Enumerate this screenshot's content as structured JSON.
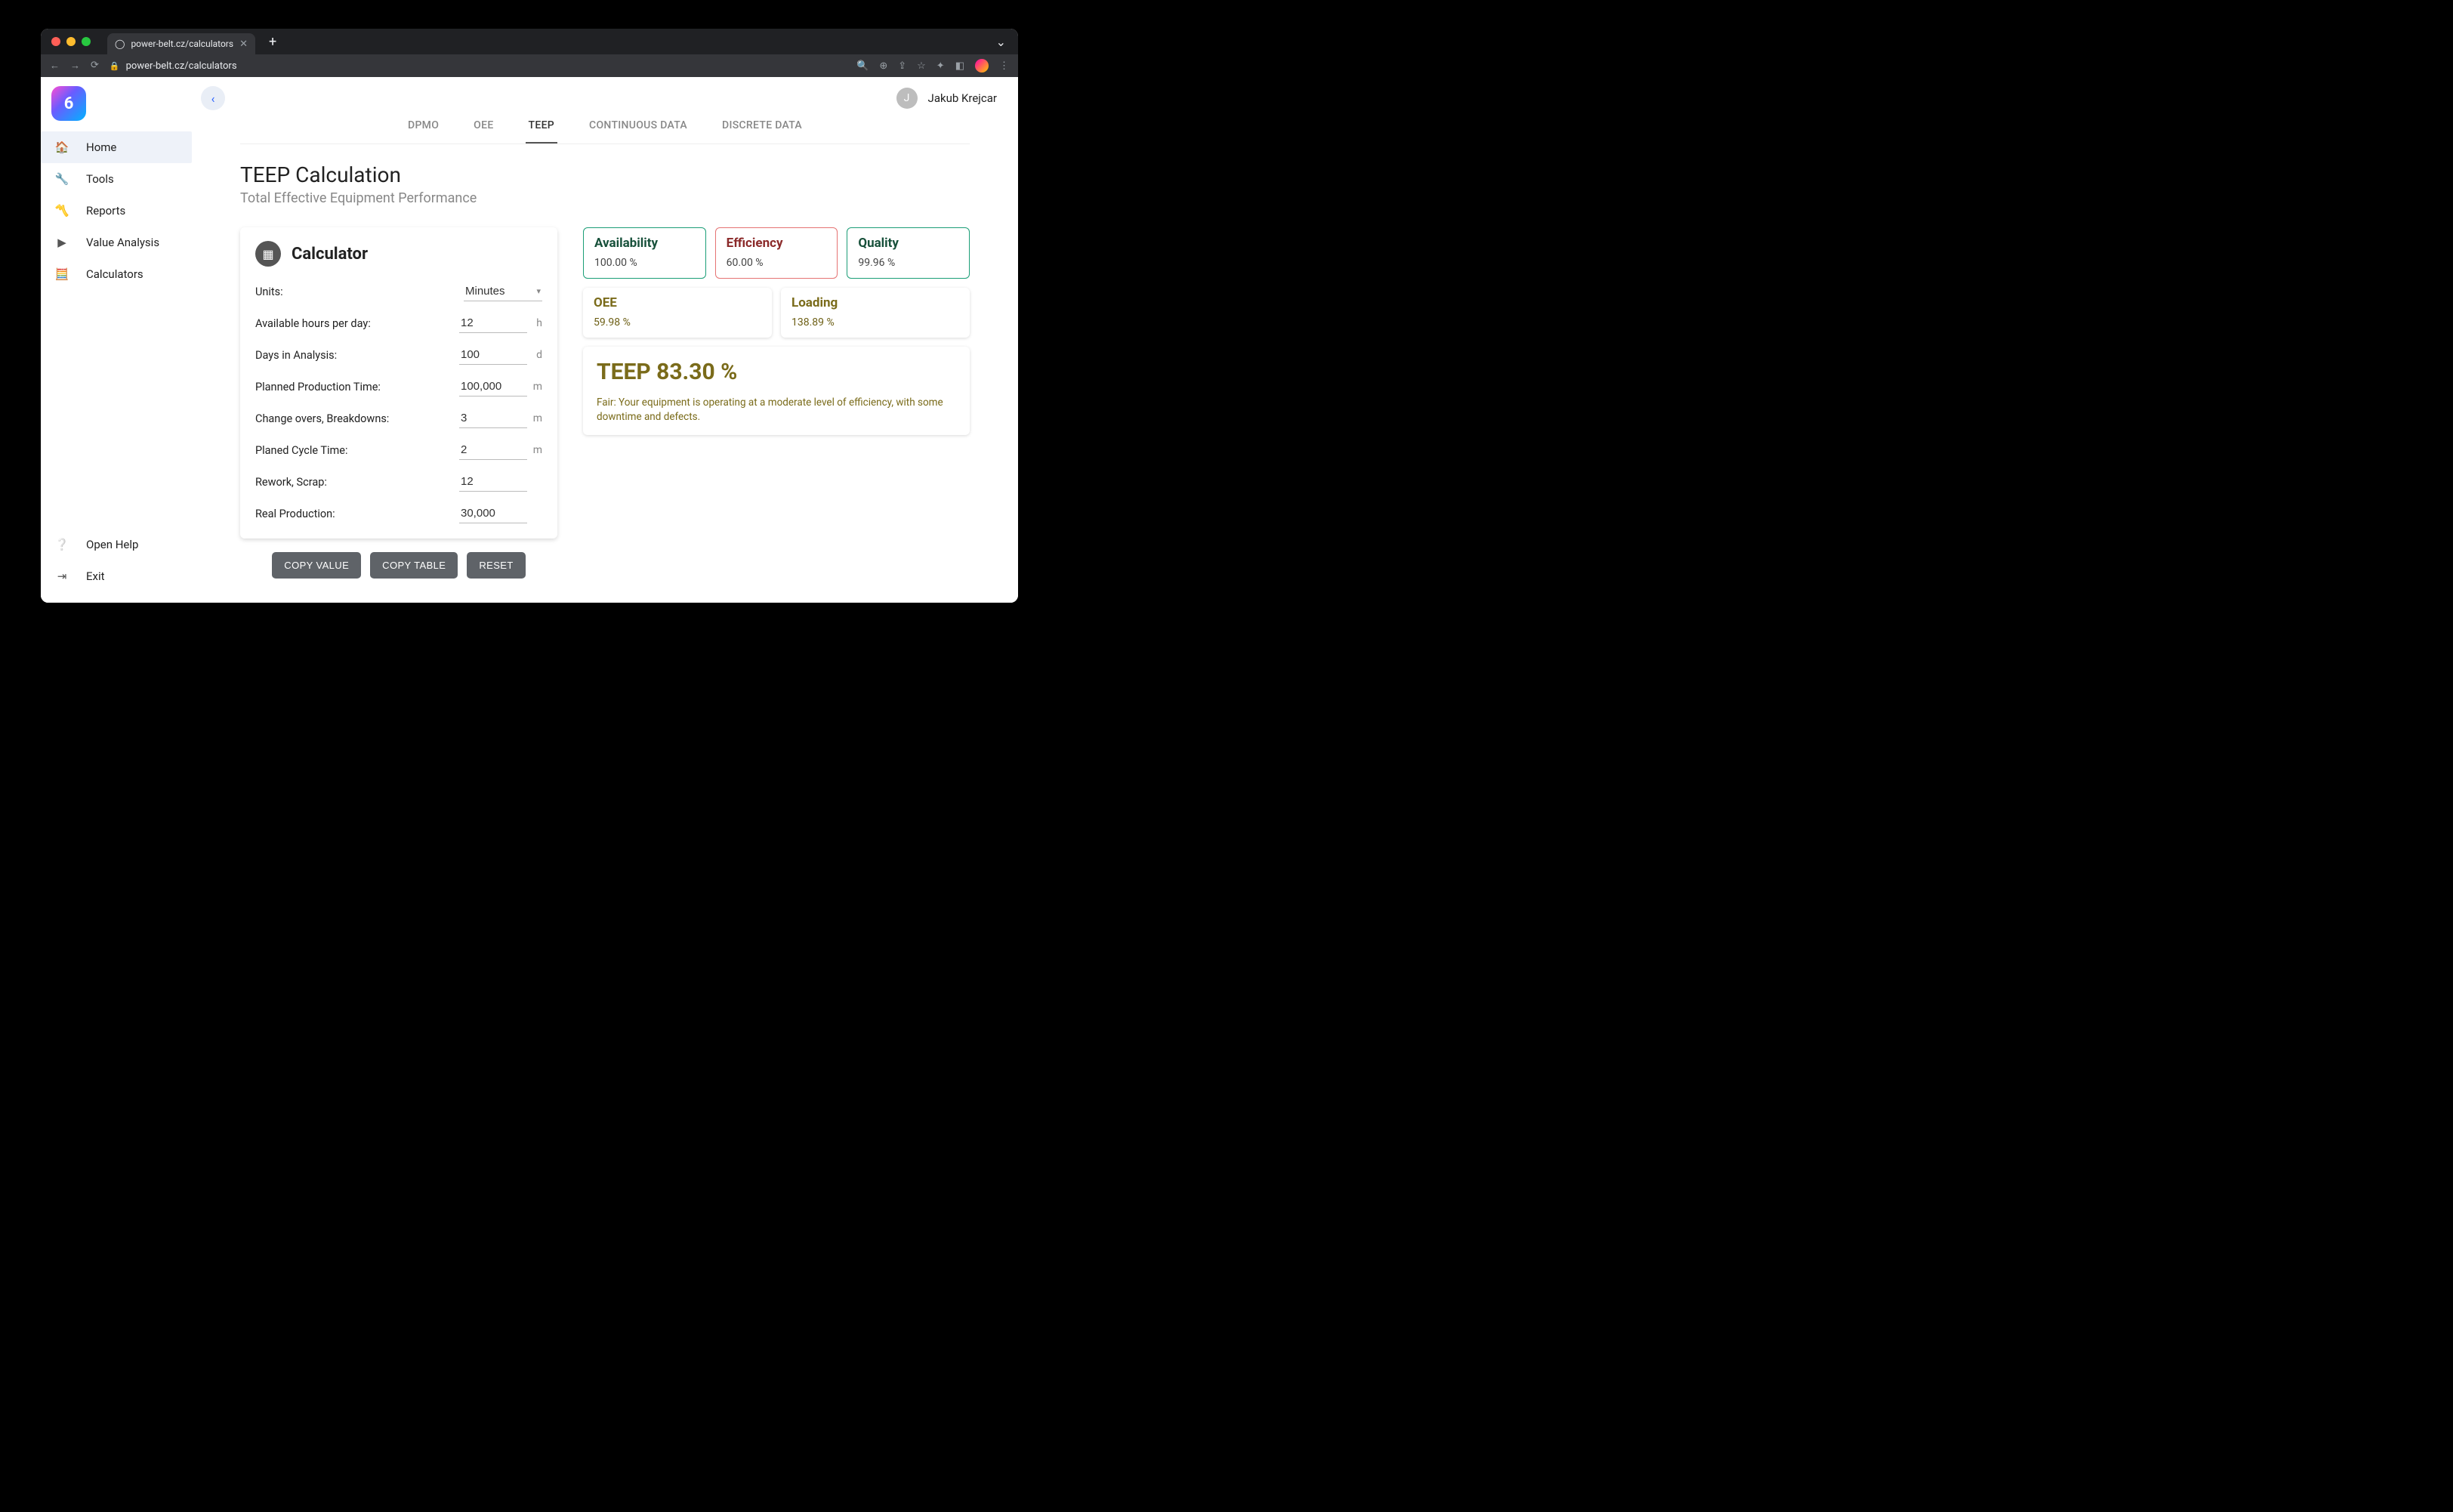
{
  "browser": {
    "tab_title": "power-belt.cz/calculators",
    "url": "power-belt.cz/calculators"
  },
  "user": {
    "name": "Jakub Krejcar",
    "initial": "J"
  },
  "sidebar": {
    "items": [
      {
        "label": "Home"
      },
      {
        "label": "Tools"
      },
      {
        "label": "Reports"
      },
      {
        "label": "Value Analysis"
      },
      {
        "label": "Calculators"
      }
    ],
    "bottom": [
      {
        "label": "Open Help"
      },
      {
        "label": "Exit"
      }
    ]
  },
  "tabs": [
    {
      "label": "DPMO"
    },
    {
      "label": "OEE"
    },
    {
      "label": "TEEP"
    },
    {
      "label": "CONTINUOUS DATA"
    },
    {
      "label": "DISCRETE DATA"
    }
  ],
  "page": {
    "title": "TEEP Calculation",
    "subtitle": "Total Effective Equipment Performance"
  },
  "calculator": {
    "title": "Calculator",
    "fields": {
      "units_label": "Units:",
      "units_value": "Minutes",
      "hours_label": "Available hours per day:",
      "hours_value": "12",
      "hours_unit": "h",
      "days_label": "Days in Analysis:",
      "days_value": "100",
      "days_unit": "d",
      "ppt_label": "Planned Production Time:",
      "ppt_value": "100,000",
      "ppt_unit": "m",
      "breakdowns_label": "Change overs, Breakdowns:",
      "breakdowns_value": "3",
      "breakdowns_unit": "m",
      "cycle_label": "Planed Cycle Time:",
      "cycle_value": "2",
      "cycle_unit": "m",
      "rework_label": "Rework, Scrap:",
      "rework_value": "12",
      "real_label": "Real Production:",
      "real_value": "30,000"
    },
    "buttons": {
      "copy_value": "COPY VALUE",
      "copy_table": "COPY TABLE",
      "reset": "RESET"
    }
  },
  "metrics": {
    "availability": {
      "title": "Availability",
      "value": "100.00 %"
    },
    "efficiency": {
      "title": "Efficiency",
      "value": "60.00 %"
    },
    "quality": {
      "title": "Quality",
      "value": "99.96 %"
    },
    "oee": {
      "title": "OEE",
      "value": "59.98 %"
    },
    "loading": {
      "title": "Loading",
      "value": "138.89 %"
    },
    "teep": {
      "big": "TEEP 83.30 %",
      "desc": "Fair: Your equipment is operating at a moderate level of efficiency, with some downtime and defects."
    }
  }
}
